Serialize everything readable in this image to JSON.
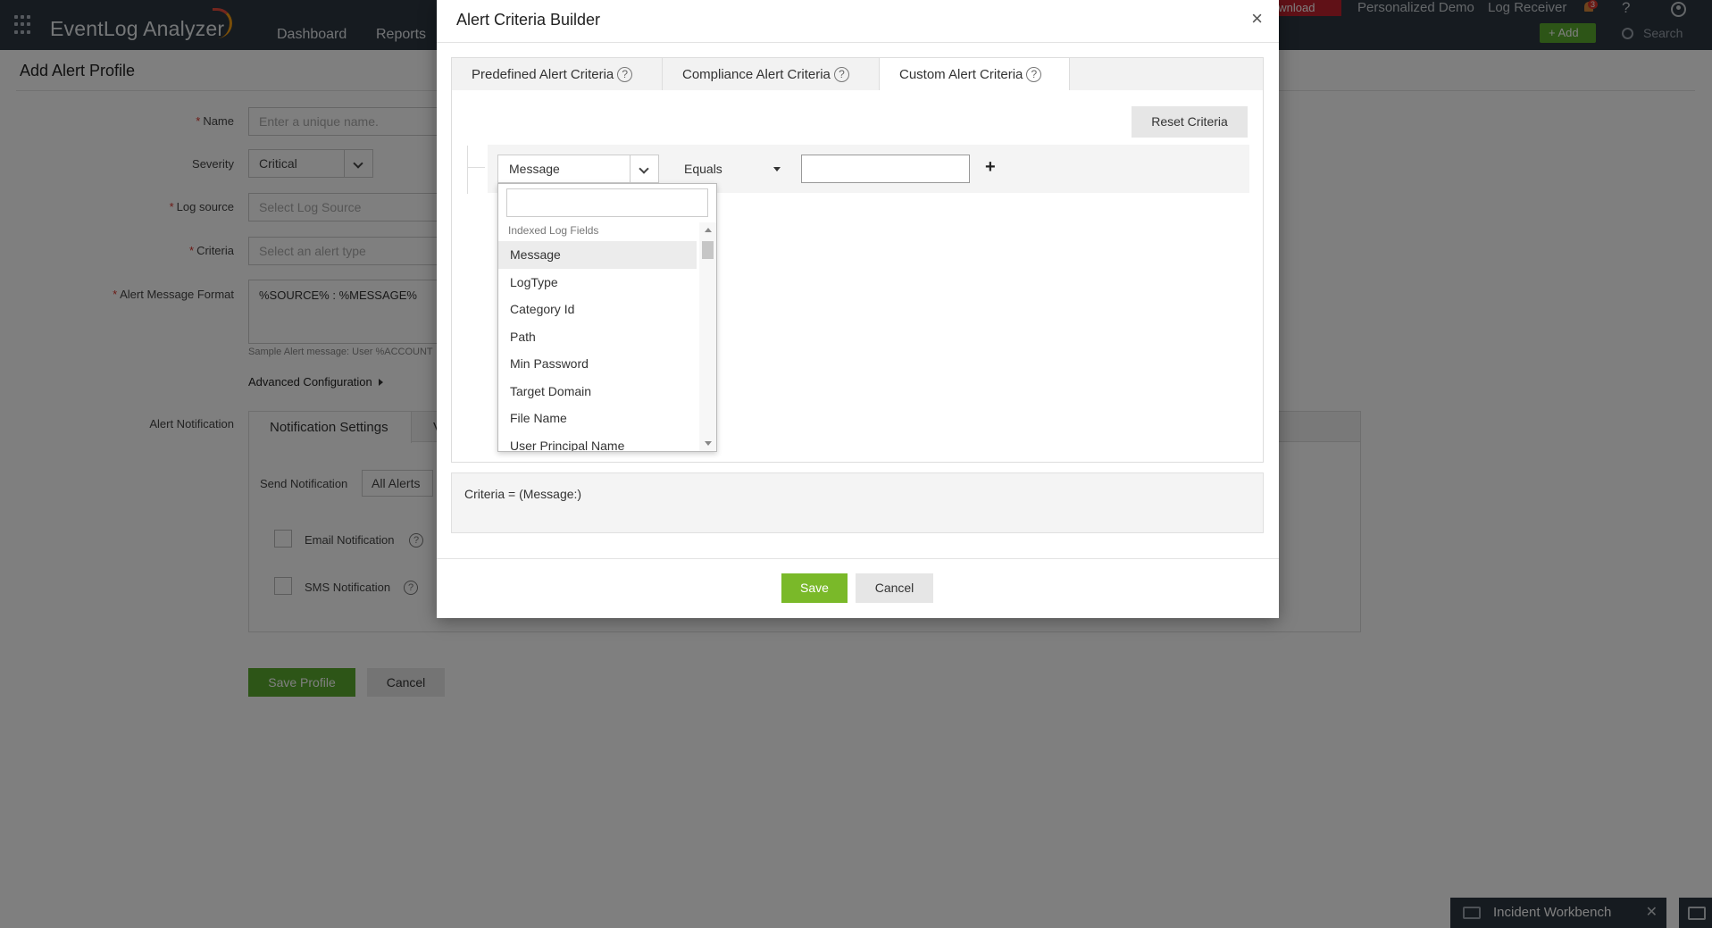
{
  "app": {
    "title": "EventLog Analyzer",
    "nav": [
      "Dashboard",
      "Reports"
    ],
    "top_links": {
      "download": "ownload",
      "personalized_demo": "Personalized Demo",
      "log_receiver": "Log Receiver",
      "bell_badge": "3",
      "help": "?",
      "add": "+ Add",
      "search": "Search"
    }
  },
  "page": {
    "title": "Add Alert Profile",
    "fields": {
      "name_label": "Name",
      "name_placeholder": "Enter a unique name.",
      "severity_label": "Severity",
      "severity_value": "Critical",
      "log_source_label": "Log source",
      "log_source_placeholder": "Select Log Source",
      "criteria_label": "Criteria",
      "criteria_placeholder": "Select an alert type",
      "message_format_label": "Alert Message Format",
      "message_format_value": "%SOURCE% : %MESSAGE%",
      "sample_text": "Sample Alert message: User %ACCOUNT",
      "advanced_config": "Advanced Configuration"
    },
    "notification": {
      "label": "Alert Notification",
      "tab_active": "Notification Settings",
      "tab_other": "V",
      "send_label": "Send Notification",
      "send_value": "All Alerts",
      "email": "Email Notification",
      "sms": "SMS Notification"
    },
    "buttons": {
      "save": "Save Profile",
      "cancel": "Cancel"
    }
  },
  "modal": {
    "title": "Alert Criteria Builder",
    "close": "×",
    "tabs": [
      "Predefined Alert Criteria",
      "Compliance Alert Criteria",
      "Custom Alert Criteria"
    ],
    "active_tab": 2,
    "reset_label": "Reset Criteria",
    "row": {
      "field": "Message",
      "operator": "Equals",
      "value": ""
    },
    "dropdown": {
      "group": "Indexed Log Fields",
      "items": [
        "Message",
        "LogType",
        "Category Id",
        "Path",
        "Min Password",
        "Target Domain",
        "File Name",
        "User Principal Name"
      ],
      "selected": "Message"
    },
    "criteria_text": "Criteria = (Message:)",
    "save_label": "Save",
    "cancel_label": "Cancel"
  },
  "footer": {
    "incident_workbench": "Incident Workbench"
  }
}
